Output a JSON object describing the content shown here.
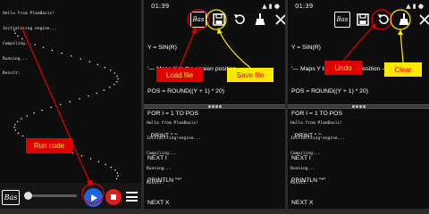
{
  "status_bar": {
    "time": "01:39",
    "icons": "▲ ▮ ●"
  },
  "console_lines": [
    "Hello from PlanBasic!",
    "Initialising engine...",
    "Compiling...",
    "Running...",
    "Result:"
  ],
  "code_lines": [
    "Y = SIN(R)",
    "'— Maps Y to the screen position —",
    "POS = ROUND((Y + 1) * 20)",
    "FOR I = 1 TO POS",
    "  PRINT \" \";",
    "NEXT I",
    "PRINTLN \"*\"",
    "NEXT X"
  ],
  "toolbar": {
    "bas_label": "Bas"
  },
  "bottom_bar": {
    "logo_label": "Bas"
  },
  "annotations": {
    "run_code": "Run code",
    "load_file": "Load file",
    "save_file": "Save file",
    "undo": "Undo",
    "clear": "Clear"
  },
  "colors": {
    "annotation_red": "#e00000",
    "annotation_yellow": "#ffe800",
    "play_blue": "#1f63e0",
    "stop_red": "#dd1e1e"
  },
  "icons": [
    "save-icon",
    "undo-icon",
    "clear-broom-icon",
    "close-icon",
    "play-icon",
    "stop-icon",
    "menu-icon"
  ]
}
